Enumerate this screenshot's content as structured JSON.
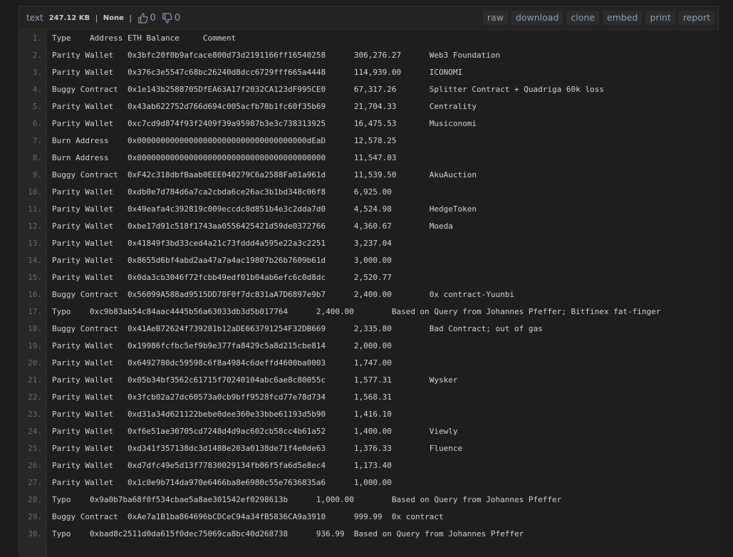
{
  "toolbar": {
    "syntax_link": "text",
    "size": "247.12 KB",
    "syntax": "None",
    "separator": "|",
    "likes": "0",
    "dislikes": "0",
    "buttons": [
      "raw",
      "download",
      "clone",
      "embed",
      "print",
      "report"
    ]
  },
  "icons": [
    "thumbs-up-icon",
    "thumbs-down-icon"
  ],
  "lines": [
    "Type    Address ETH Balance     Comment",
    "Parity Wallet   0x3bfc20f0b9afcace800d73d2191166ff16540258      306,276.27      Web3 Foundation",
    "Parity Wallet   0x376c3e5547c68bc26240d8dcc6729fff665a4448      114,939.00      ICONOMI",
    "Buggy Contract  0x1e143b2588705DfEA63A17f2032CA123dF995CE0      67,317.26       Splitter Contract + Quadriga 60k loss",
    "Parity Wallet   0x43ab622752d766d694c005acfb78b1fc60f35b69      21,704.33       Centrality",
    "Parity Wallet   0xc7cd9d874f93f2409f39a95987b3e3c738313925      16,475.53       Musiconomi",
    "Burn Address    0x000000000000000000000000000000000000dEaD      12,578.25",
    "Burn Address    0x0000000000000000000000000000000000000000      11,547.03",
    "Buggy Contract  0xF42c318dbfBaab0EEE040279C6a2588Fa01a961d      11,539.50       AkuAuction",
    "Parity Wallet   0xdb0e7d784d6a7ca2cbda6ce26ac3b1bd348c06f8      6,925.00",
    "Parity Wallet   0x49eafa4c392819c009eccdc8d851b4e3c2dda7d0      4,524.98        HedgeToken",
    "Parity Wallet   0xbe17d91c518f1743aa0556425421d59de0372766      4,360.67        Moeda",
    "Parity Wallet   0x41849f3bd33ced4a21c73fddd4a595e22a3c2251      3,237.04",
    "Parity Wallet   0x8655d6bf4abd2aa47a7a4ac19807b26b7609b61d      3,000.00",
    "Parity Wallet   0x0da3cb3046f72fcbb49edf01b04ab6efc6c0d8dc      2,520.77",
    "Buggy Contract  0x56099A588ad9515DD78F0f7dc831aA7D6897e9b7      2,400.00        0x contract-Yuunbi",
    "Typo    0xc9b83ab54c84aac4445b56a63033db3d5b017764      2,400.00        Based on Query from Johannes Pfeffer; Bitfinex fat-finger",
    "Buggy Contract  0x41AeB72624f739281b12aDE663791254F32DB669      2,335.80        Bad Contract; out of gas",
    "Parity Wallet   0x19986fcfbc5ef9b9e377fa8429c5a8d215cbe814      2,000.00",
    "Parity Wallet   0x6492780dc59598c6f8a4984c6deffd4600ba0003      1,747.00",
    "Parity Wallet   0x05b34bf3562c61715f70240104abc6ae8c80055c      1,577.31        Wysker",
    "Parity Wallet   0x3fcb02a27dc60573a0cb9bff9528fcd77e78d734      1,568.31",
    "Parity Wallet   0xd31a34d621122bebe0dee360e33bbe61193d5b90      1,416.10",
    "Parity Wallet   0xf6e51ae30705cd7248d4d9ac602cb58cc4b61a52      1,400.00        Viewly",
    "Parity Wallet   0xd341f357138dc3d1488e203a0138de71f4e0de63      1,376.33        Fluence",
    "Parity Wallet   0xd7dfc49e5d13f77830029134fb06f5fa6d5e8ec4      1,173.40",
    "Parity Wallet   0x1c0e9b714da970e6466ba8e6980c55e7636835a6      1,000.00",
    "Typo    0x9a0b7ba68f0f534cbae5a8ae301542ef0298613b      1,000.00        Based on Query from Johannes Pfeffer",
    "Buggy Contract  0xAe7a1B1ba864696bCDCeC94a34fB5836CA9a3910      999.99  0x contract",
    "Typo    0xbad8c2511d0da615f0dec75069ca8bc40d268738      936.99  Based on Query from Johannes Pfeffer"
  ]
}
